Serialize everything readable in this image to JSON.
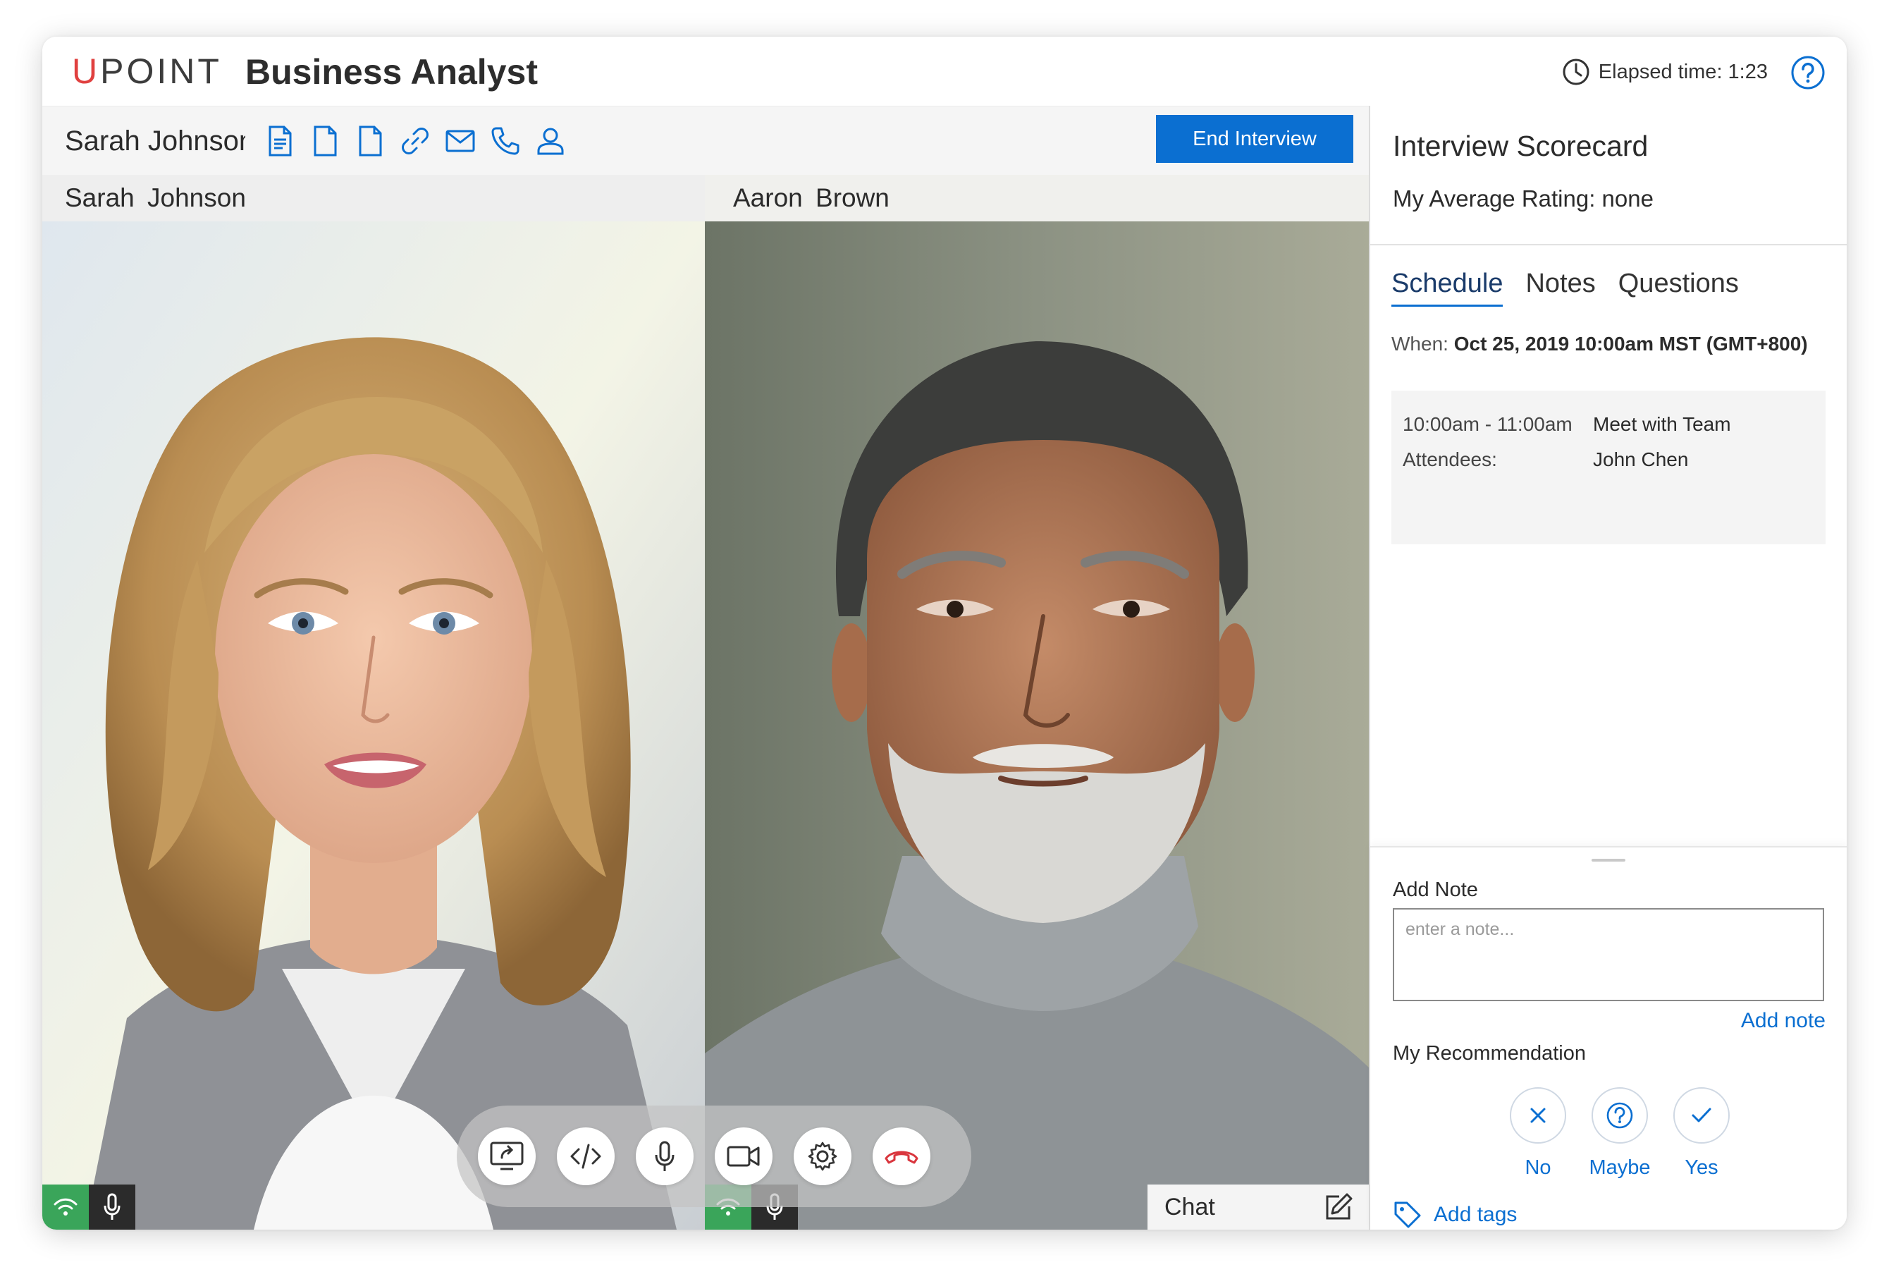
{
  "header": {
    "logo_text": "UPOINT",
    "title": "Business Analyst",
    "elapsed_label": "Elapsed time: 1:23",
    "help_icon": "question-circle-icon"
  },
  "toolbar": {
    "candidate_name": "Sarah Johnson",
    "icons": [
      "resume-document-icon",
      "document-icon",
      "document-icon",
      "link-icon",
      "envelope-icon",
      "phone-icon",
      "user-icon"
    ],
    "end_button_label": "End Interview"
  },
  "videos": [
    {
      "name": "Sarah Johnson",
      "signal": "wifi-icon",
      "audio": "microphone-icon"
    },
    {
      "name": "Aaron Brown",
      "signal": "wifi-icon",
      "audio": "microphone-icon"
    }
  ],
  "call_controls": [
    "screen-share-icon",
    "code-icon",
    "microphone-icon",
    "video-camera-icon",
    "settings-gear-icon",
    "hang-up-icon"
  ],
  "chat": {
    "label": "Chat",
    "icon": "compose-icon"
  },
  "scorecard": {
    "title": "Interview Scorecard",
    "average_rating": "My Average Rating: none",
    "tabs": [
      {
        "label": "Schedule",
        "active": true
      },
      {
        "label": "Notes",
        "active": false
      },
      {
        "label": "Questions",
        "active": false
      }
    ],
    "when_label": "When:",
    "when_value": "Oct 25, 2019 10:00am MST (GMT+800)",
    "schedule": {
      "time": "10:00am - 11:00am",
      "event": "Meet with Team",
      "attendees_label": "Attendees:",
      "attendees": "John Chen"
    }
  },
  "note": {
    "label": "Add Note",
    "placeholder": "enter a note...",
    "add_link": "Add note"
  },
  "recommendation": {
    "label": "My Recommendation",
    "options": [
      {
        "label": "No",
        "icon": "x-icon"
      },
      {
        "label": "Maybe",
        "icon": "question-icon"
      },
      {
        "label": "Yes",
        "icon": "check-icon"
      }
    ]
  },
  "tags": {
    "label": "Add tags",
    "icon": "tag-icon"
  },
  "colors": {
    "accent": "#0b6fd1",
    "logo_red": "#e0403f",
    "signal_green": "#3aa55a",
    "hangup_red": "#d9363e"
  }
}
